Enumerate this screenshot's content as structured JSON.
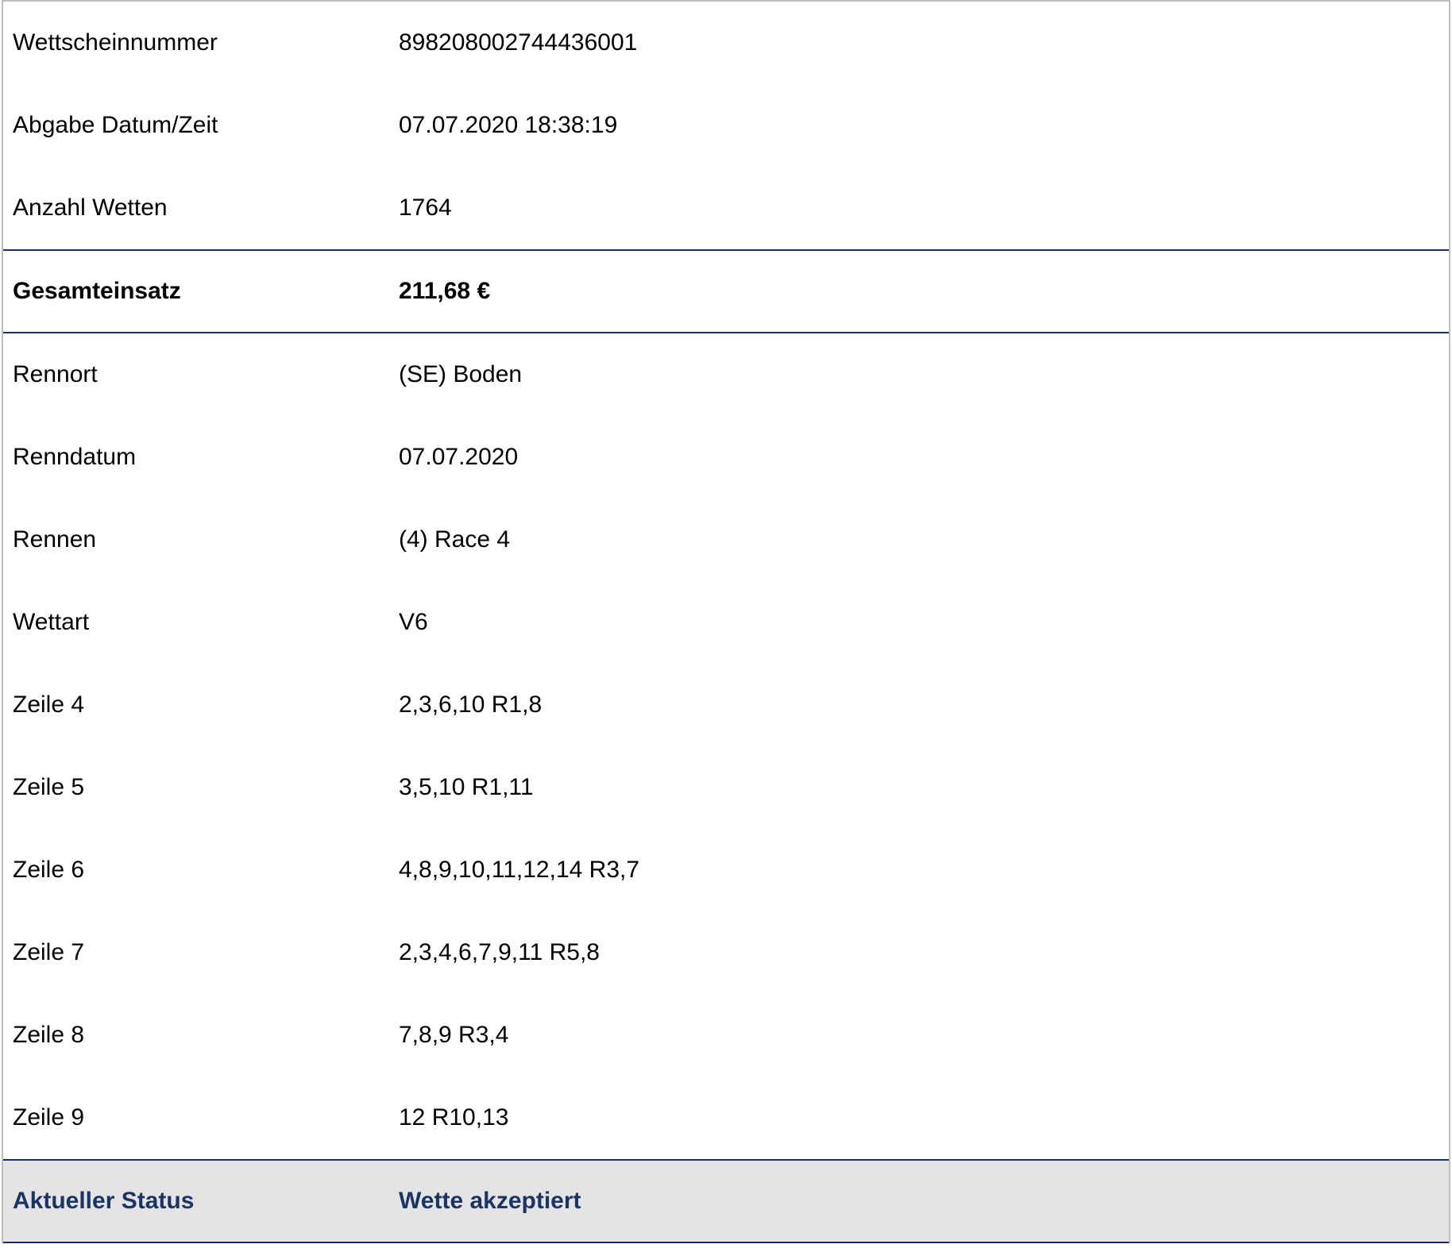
{
  "ticket": {
    "header_rows": [
      {
        "label": "Wettscheinnummer",
        "value": "898208002744436001"
      },
      {
        "label": "Abgabe Datum/Zeit",
        "value": "07.07.2020 18:38:19"
      },
      {
        "label": "Anzahl Wetten",
        "value": "1764"
      }
    ],
    "total": {
      "label": "Gesamteinsatz",
      "value": "211,68 €"
    },
    "detail_rows": [
      {
        "label": "Rennort",
        "value": "(SE) Boden"
      },
      {
        "label": "Renndatum",
        "value": "07.07.2020"
      },
      {
        "label": "Rennen",
        "value": "(4) Race 4"
      },
      {
        "label": "Wettart",
        "value": "V6"
      },
      {
        "label": "Zeile 4",
        "value": "2,3,6,10 R1,8"
      },
      {
        "label": "Zeile 5",
        "value": "3,5,10 R1,11"
      },
      {
        "label": "Zeile 6",
        "value": "4,8,9,10,11,12,14 R3,7"
      },
      {
        "label": "Zeile 7",
        "value": "2,3,4,6,7,9,11 R5,8"
      },
      {
        "label": "Zeile 8",
        "value": "7,8,9 R3,4"
      },
      {
        "label": "Zeile 9",
        "value": "12 R10,13"
      }
    ],
    "status": {
      "label": "Aktueller Status",
      "value": "Wette akzeptiert"
    }
  },
  "colors": {
    "divider": "#1b3060",
    "status_background": "#e4e4e4",
    "status_text": "#1b3466",
    "outer_border": "#bdbdbd"
  }
}
